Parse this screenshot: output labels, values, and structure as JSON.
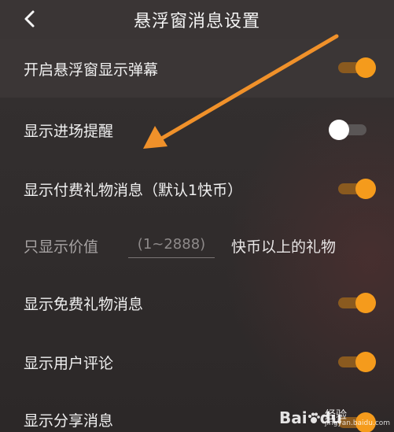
{
  "header": {
    "title": "悬浮窗消息设置",
    "back_icon": "chevron-left-icon"
  },
  "settings": [
    {
      "label": "开启悬浮窗显示弹幕",
      "enabled": true
    },
    {
      "label": "显示进场提醒",
      "enabled": false
    },
    {
      "label": "显示付费礼物消息（默认1快币）",
      "enabled": true
    },
    {
      "label": "显示免费礼物消息",
      "enabled": true
    },
    {
      "label": "显示用户评论",
      "enabled": true
    },
    {
      "label": "显示分享消息",
      "enabled": true
    }
  ],
  "value_filter": {
    "prefix": "只显示价值",
    "placeholder": "(1~2888)",
    "suffix": "快币以上的礼物"
  },
  "colors": {
    "accent": "#f59b1c",
    "annotation_arrow": "#f0912a",
    "background": "#2f2b2b"
  },
  "watermark": {
    "logo": "Bai",
    "logo_icon": "paw-icon",
    "logo_tail": "du",
    "cn": "经验",
    "sub": "jingyan.baidu.com"
  }
}
